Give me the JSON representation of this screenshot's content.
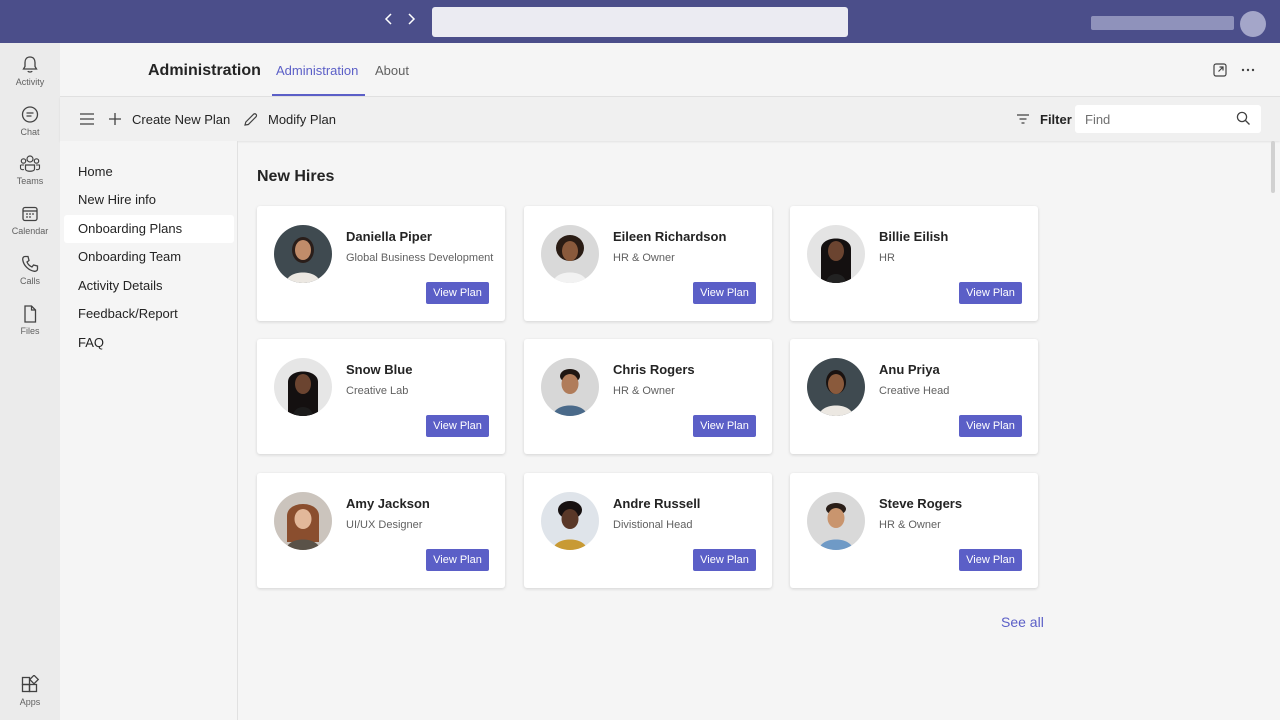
{
  "header": {
    "app_title": "Administration",
    "tabs": [
      {
        "label": "Administration",
        "active": true
      },
      {
        "label": "About",
        "active": false
      }
    ]
  },
  "rail": [
    {
      "label": "Activity",
      "icon": "bell-icon"
    },
    {
      "label": "Chat",
      "icon": "chat-icon"
    },
    {
      "label": "Teams",
      "icon": "teams-icon"
    },
    {
      "label": "Calendar",
      "icon": "calendar-icon"
    },
    {
      "label": "Calls",
      "icon": "phone-icon"
    },
    {
      "label": "Files",
      "icon": "file-icon"
    },
    {
      "label": "Apps",
      "icon": "apps-icon"
    }
  ],
  "toolbar": {
    "create_label": "Create New Plan",
    "modify_label": "Modify Plan",
    "filter_label": "Filter",
    "find_placeholder": "Find"
  },
  "leftnav": {
    "items": [
      {
        "label": "Home",
        "active": false
      },
      {
        "label": "New Hire info",
        "active": false
      },
      {
        "label": "Onboarding Plans",
        "active": true
      },
      {
        "label": "Onboarding Team",
        "active": false
      },
      {
        "label": "Activity Details",
        "active": false
      },
      {
        "label": "Feedback/Report",
        "active": false
      },
      {
        "label": "FAQ",
        "active": false
      }
    ]
  },
  "main": {
    "section_title": "New Hires",
    "view_label": "View Plan",
    "see_all": "See all",
    "hires": [
      {
        "name": "Daniella Piper",
        "role": "Global Business Development"
      },
      {
        "name": "Eileen Richardson",
        "role": "HR & Owner"
      },
      {
        "name": "Billie Eilish",
        "role": "HR"
      },
      {
        "name": "Snow Blue",
        "role": "Creative Lab"
      },
      {
        "name": "Chris Rogers",
        "role": "HR & Owner"
      },
      {
        "name": "Anu Priya",
        "role": "Creative Head"
      },
      {
        "name": "Amy Jackson",
        "role": "UI/UX Designer"
      },
      {
        "name": "Andre Russell",
        "role": "Divistional Head"
      },
      {
        "name": "Steve Rogers",
        "role": "HR & Owner"
      }
    ]
  },
  "colors": {
    "title_bar": "#4b4e8a",
    "accent": "#5b5fc7"
  }
}
